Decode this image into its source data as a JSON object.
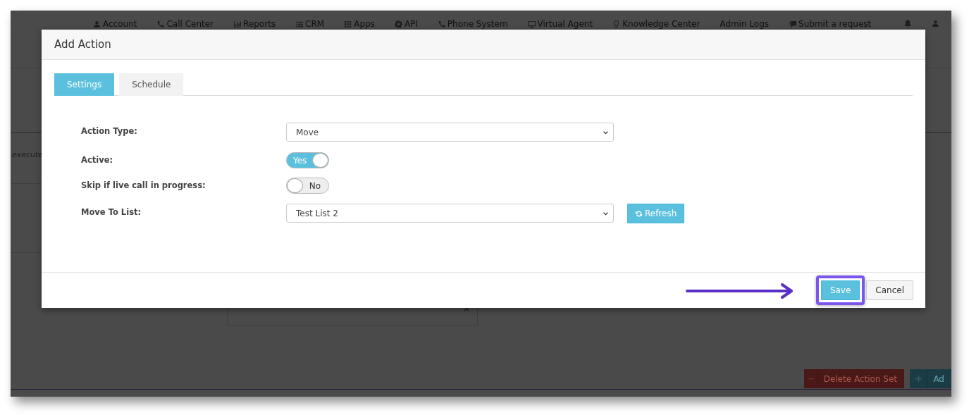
{
  "background_page": {
    "nav": [
      "Account",
      "Call Center",
      "Reports",
      "CRM",
      "Apps",
      "API",
      "Phone System",
      "Virtual Agent",
      "Knowledge Center",
      "Admin Logs",
      "Submit a request"
    ],
    "row_text": "execute",
    "buttons": [
      {
        "label": "Delete Action Set",
        "kind": "danger"
      },
      {
        "label": "Ad",
        "kind": "add"
      }
    ]
  },
  "modal": {
    "title": "Add Action",
    "tabs": [
      {
        "label": "Settings",
        "selected": true
      },
      {
        "label": "Schedule",
        "selected": false
      }
    ],
    "fields": [
      {
        "kind": "select",
        "label": "Action Type:",
        "value": "Move"
      },
      {
        "kind": "toggle",
        "label": "Active:",
        "on": true,
        "text": "Yes"
      },
      {
        "kind": "toggle",
        "label": "Skip if live call in progress:",
        "on": false,
        "text": "No"
      },
      {
        "kind": "select",
        "label": "Move To List:",
        "value": "Test List 2",
        "button": "Refresh"
      }
    ],
    "footer_buttons": [
      {
        "label": "Save",
        "kind": "primary",
        "highlighted": true
      },
      {
        "label": "Cancel",
        "kind": "default",
        "highlighted": false
      }
    ]
  }
}
